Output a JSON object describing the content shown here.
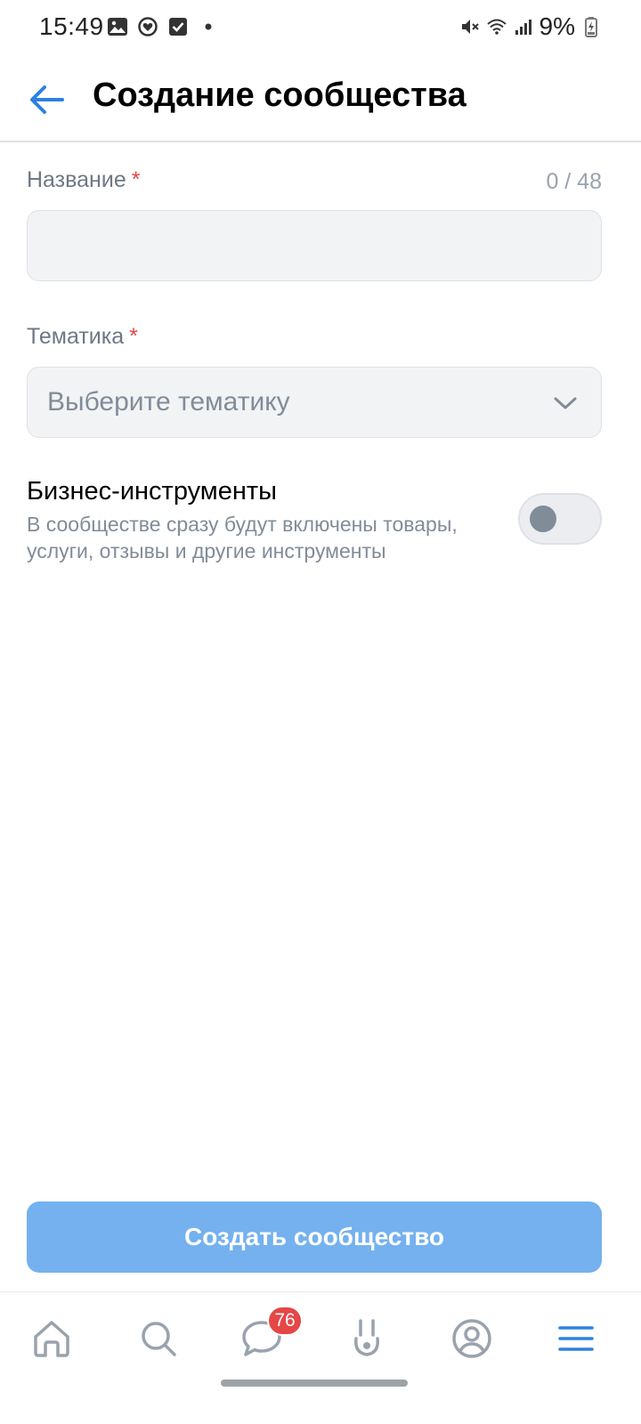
{
  "status_bar": {
    "time": "15:49",
    "battery": "9%",
    "icons_left": [
      "image-icon",
      "vk-notification-icon",
      "check-box-icon",
      "dot-icon"
    ],
    "icons_right": [
      "mute-icon",
      "wifi-icon",
      "signal-icon",
      "battery-charging-icon"
    ]
  },
  "header": {
    "title": "Создание сообщества",
    "back_icon": "arrow-left-icon"
  },
  "form": {
    "name": {
      "label": "Название",
      "required_mark": "*",
      "counter": "0 / 48",
      "value": ""
    },
    "topic": {
      "label": "Тематика",
      "required_mark": "*",
      "placeholder": "Выберите тематику",
      "icon": "chevron-down-icon"
    },
    "business_tools": {
      "title": "Бизнес-инструменты",
      "description": "В сообществе сразу будут включены товары, услуги, отзывы и другие инструменты",
      "enabled": false
    }
  },
  "create_button": {
    "label": "Создать сообщество"
  },
  "bottom_nav": {
    "items": [
      {
        "name": "home",
        "icon": "home-icon"
      },
      {
        "name": "search",
        "icon": "search-icon"
      },
      {
        "name": "messages",
        "icon": "chat-icon",
        "badge": "76"
      },
      {
        "name": "clips",
        "icon": "clips-icon"
      },
      {
        "name": "profile",
        "icon": "user-circle-icon"
      },
      {
        "name": "menu",
        "icon": "menu-icon"
      }
    ]
  },
  "colors": {
    "accent": "#2d81e0",
    "button_disabled": "#74b1ee",
    "required": "#e64646",
    "badge": "#e64646",
    "secondary_text": "#818c99"
  }
}
